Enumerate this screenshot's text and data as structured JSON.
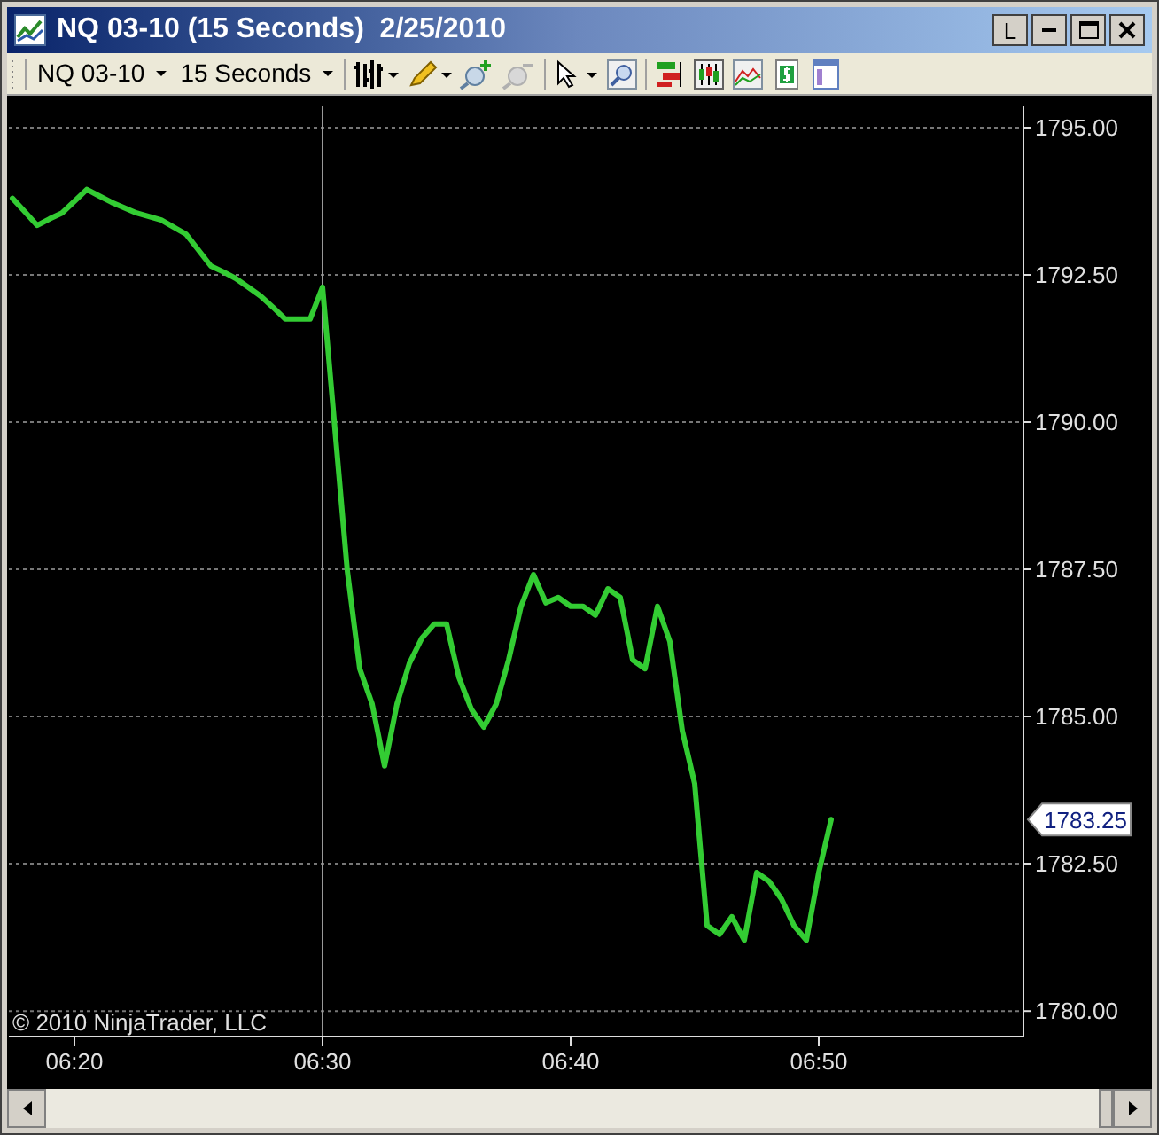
{
  "window": {
    "title": "NQ 03-10 (15 Seconds)  2/25/2010",
    "buttons": [
      "L"
    ]
  },
  "toolbar": {
    "instrument": "NQ 03-10",
    "interval": "15 Seconds"
  },
  "chart": {
    "copyright": "© 2010 NinjaTrader, LLC",
    "last_price": "1783.25",
    "chart_data": {
      "type": "line",
      "grid": true,
      "ylim": [
        1779.58,
        1795.36
      ],
      "categories": [
        null,
        null,
        null,
        null,
        null,
        "06:20",
        null,
        null,
        null,
        null,
        null,
        null,
        null,
        null,
        null,
        null,
        null,
        null,
        null,
        null,
        null,
        null,
        null,
        null,
        null,
        "06:30",
        null,
        null,
        null,
        null,
        null,
        null,
        null,
        null,
        null,
        null,
        null,
        null,
        null,
        null,
        null,
        null,
        null,
        null,
        null,
        "06:40",
        null,
        null,
        null,
        null,
        null,
        null,
        null,
        null,
        null,
        null,
        null,
        null,
        null,
        null,
        null,
        null,
        null,
        null,
        null,
        "06:50",
        null
      ],
      "series": [
        {
          "color": "#33cc33",
          "values": [
            1793.8,
            1793.57,
            1793.34,
            1793.45,
            1793.55,
            1793.75,
            1793.95,
            1793.84,
            1793.73,
            1793.64,
            1793.55,
            1793.49,
            1793.43,
            1793.31,
            1793.19,
            1792.92,
            1792.65,
            1792.55,
            1792.44,
            1792.29,
            1792.14,
            1791.95,
            1791.75,
            1791.75,
            1791.75,
            1792.29,
            1789.88,
            1787.47,
            1785.81,
            1785.21,
            1784.16,
            1785.21,
            1785.9,
            1786.33,
            1786.57,
            1786.57,
            1785.66,
            1785.12,
            1784.82,
            1785.21,
            1785.96,
            1786.87,
            1787.41,
            1786.93,
            1787.02,
            1786.87,
            1786.87,
            1786.72,
            1787.17,
            1787.02,
            1785.96,
            1785.81,
            1786.87,
            1786.27,
            1784.76,
            1783.86,
            1781.45,
            1781.3,
            1781.6,
            1781.2,
            1782.35,
            1782.2,
            1781.9,
            1781.45,
            1781.2,
            1782.35,
            1783.25
          ]
        }
      ],
      "yticks": [
        {
          "value": 1780,
          "label": "1780.00"
        },
        {
          "value": 1782.5,
          "label": "1782.50"
        },
        {
          "value": 1785,
          "label": "1785.00"
        },
        {
          "value": 1787.5,
          "label": "1787.50"
        },
        {
          "value": 1790,
          "label": "1790.00"
        },
        {
          "value": 1792.5,
          "label": "1792.50"
        },
        {
          "value": 1795,
          "label": "1795.00"
        }
      ]
    }
  }
}
